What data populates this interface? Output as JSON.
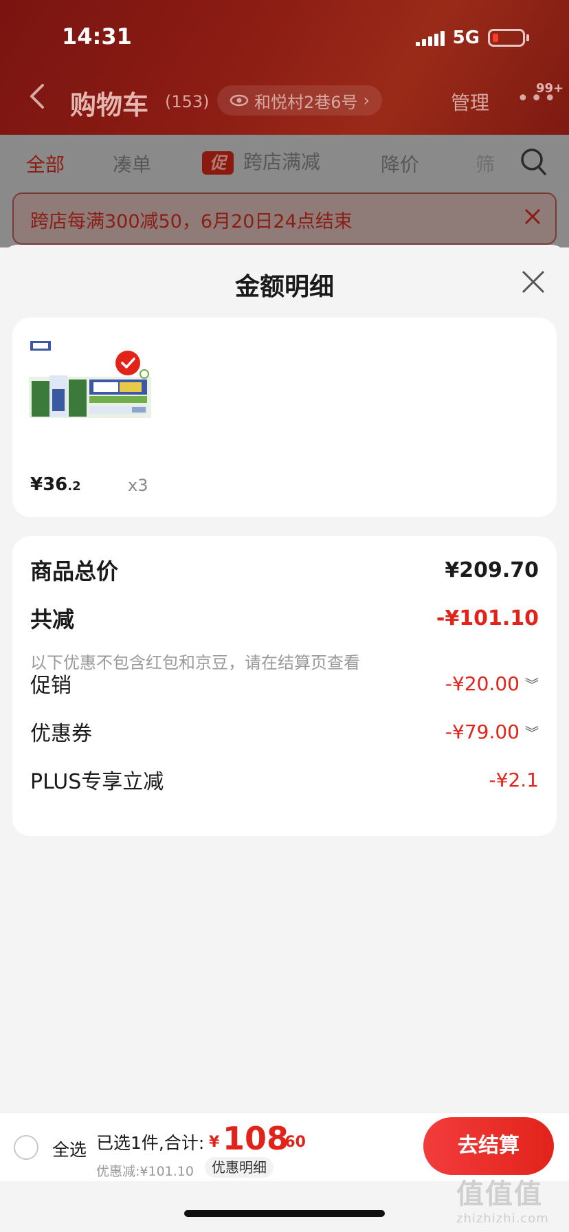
{
  "status": {
    "time": "14:31",
    "network": "5G"
  },
  "nav": {
    "title": "购物车",
    "count": "(153)",
    "address": "和悦村2巷6号",
    "manage": "管理",
    "badge": "99+"
  },
  "tabs": [
    {
      "label": "全部",
      "active": true
    },
    {
      "label": "凑单"
    },
    {
      "tag": "促",
      "label": "跨店满减"
    },
    {
      "label": "降价"
    },
    {
      "label": "筛"
    }
  ],
  "promo_banner": {
    "text": "跨店每满300减50，6月20日24点结束"
  },
  "sheet": {
    "title": "金额明细",
    "product": {
      "price_int": "¥36",
      "price_dec": ".2",
      "qty": "x3"
    },
    "total": {
      "label": "商品总价",
      "value": "¥209.70"
    },
    "reduction": {
      "label": "共减",
      "value": "-¥101.10",
      "note": "以下优惠不包含红包和京豆，请在结算页查看"
    },
    "items": [
      {
        "label": "促销",
        "value": "-¥20.00",
        "expandable": true
      },
      {
        "label": "优惠券",
        "value": "-¥79.00",
        "expandable": true
      },
      {
        "label": "PLUS专享立减",
        "value": "-¥2.1",
        "expandable": false
      }
    ]
  },
  "bottom": {
    "select_all": "全选",
    "summary": "已选1件,合计:",
    "currency": "¥",
    "total_int": "108",
    "total_dec": ".60",
    "discount": "优惠减:¥101.10",
    "detail_btn": "优惠明细",
    "checkout": "去结算"
  },
  "watermark": {
    "big": "值值值",
    "small": "zhizhizhi.com"
  },
  "colors": {
    "accent": "#e2231a",
    "header": "#8b1c14",
    "overlay": "#8a8a8a"
  }
}
